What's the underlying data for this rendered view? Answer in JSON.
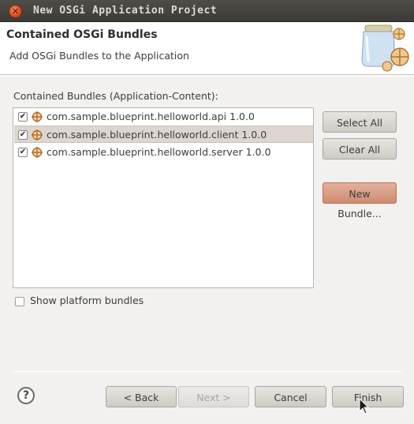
{
  "window": {
    "title": "New OSGi Application Project",
    "close_glyph": "✕"
  },
  "header": {
    "title": "Contained OSGi Bundles",
    "description": "Add OSGi Bundles to the Application",
    "image_icon": "jar-of-bundles-icon"
  },
  "list": {
    "label": "Contained Bundles (Application-Content):",
    "items": [
      {
        "label": "com.sample.blueprint.helloworld.api 1.0.0",
        "checked": true,
        "selected": false
      },
      {
        "label": "com.sample.blueprint.helloworld.client 1.0.0",
        "checked": true,
        "selected": true
      },
      {
        "label": "com.sample.blueprint.helloworld.server 1.0.0",
        "checked": true,
        "selected": false
      }
    ],
    "check_glyph": "✔",
    "item_icon": "bundle-icon"
  },
  "side_buttons": {
    "select_all": "Select All",
    "clear_all": "Clear All",
    "new_bundle": "New Bundle..."
  },
  "platform": {
    "label": "Show platform bundles",
    "checked": false
  },
  "footer": {
    "help_glyph": "?",
    "back": "< Back",
    "next": "Next >",
    "cancel": "Cancel",
    "finish": "Finish"
  },
  "colors": {
    "titlebar": "#3c3b37",
    "close_button": "#e0491b",
    "focused_button": "#cd8c72",
    "selection": "#dcd6cf"
  }
}
